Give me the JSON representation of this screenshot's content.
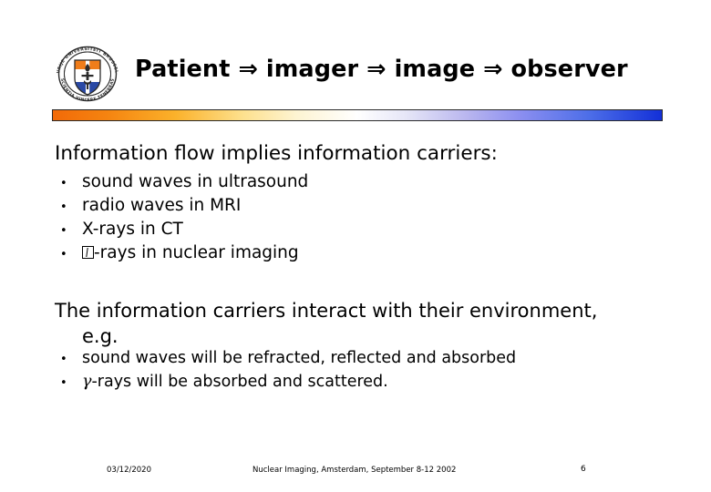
{
  "slide": {
    "title": "Patient ⇒ imager ⇒ image ⇒ observer",
    "logo": {
      "name": "vub-university-seal",
      "top_motto": "VRIJE UNIVERSITEIT BRUSSEL",
      "bottom_motto": "SCIENTIA VINCERE TENEBRAS",
      "colors": {
        "orange": "#f07d1a",
        "blue": "#2a49a5",
        "white": "#ffffff",
        "outline": "#2b2b2b"
      }
    },
    "divider": {
      "name": "gradient-rule",
      "start_color": "#f26a08",
      "mid_color": "#ffffff",
      "end_color": "#1330d8"
    },
    "lead_line_1": "Information flow implies information carriers:",
    "bullets_1": [
      {
        "marker": "•",
        "text": "sound waves in ultrasound"
      },
      {
        "marker": "•",
        "text": "radio waves in MRI"
      },
      {
        "marker": "•",
        "text": "X-rays in CT"
      },
      {
        "marker": "•",
        "text": "-rays in nuclear imaging",
        "prefix_glyph": "missing-glyph-box"
      }
    ],
    "paragraph": {
      "line_1": "The information carriers interact with their environment,",
      "line_2": "e.g."
    },
    "bullets_2": [
      {
        "marker": "•",
        "text": "sound waves will be refracted, reflected and absorbed"
      },
      {
        "marker": "•",
        "text": "-rays will be absorbed and scattered.",
        "prefix_glyph": "γ"
      }
    ],
    "footer": {
      "date": "03/12/2020",
      "center": "Nuclear Imaging, Amsterdam, September 8-12 2002",
      "page": "6"
    }
  }
}
